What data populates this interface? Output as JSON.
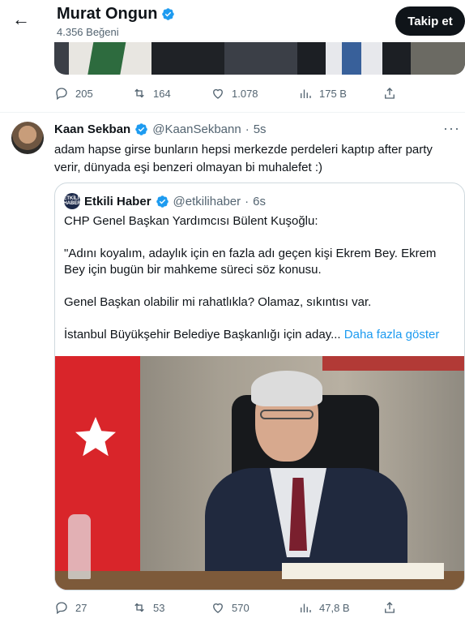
{
  "header": {
    "back_icon": "arrow-left-icon",
    "name": "Murat Ongun",
    "subtitle": "4.356 Beğeni",
    "follow_label": "Takip et"
  },
  "tweet1": {
    "actions": {
      "replies": "205",
      "retweets": "164",
      "likes": "1.078",
      "views": "175 B"
    }
  },
  "tweet2": {
    "name": "Kaan Sekban",
    "handle": "@KaanSekbann",
    "dot": "·",
    "time": "5s",
    "more": "···",
    "text": "adam hapse girse bunların hepsi merkezde perdeleri kaptıp after party verir, dünyada eşi benzeri olmayan bi muhalefet :)",
    "quote": {
      "avatar_text": "ETKİLİ HABER",
      "name": "Etkili Haber",
      "handle": "@etkilihaber",
      "dot": "·",
      "time": "6s",
      "paragraphs": [
        "CHP Genel Başkan Yardımcısı Bülent Kuşoğlu:",
        "\"Adını koyalım, adaylık için en fazla adı geçen kişi Ekrem Bey. Ekrem Bey için bugün bir mahkeme süreci söz konusu.",
        "Genel Başkan olabilir mi rahatlıkla? Olamaz, sıkıntısı var."
      ],
      "last_line": "İstanbul Büyükşehir Belediye Başkanlığı için aday...",
      "show_more": "Daha fazla göster"
    },
    "actions": {
      "replies": "27",
      "retweets": "53",
      "likes": "570",
      "views": "47,8 B"
    }
  },
  "colors": {
    "text": "#0f1419",
    "secondary": "#536471",
    "link": "#1d9bf0",
    "verified": "#1d9bf0",
    "border": "#cfd9de"
  }
}
